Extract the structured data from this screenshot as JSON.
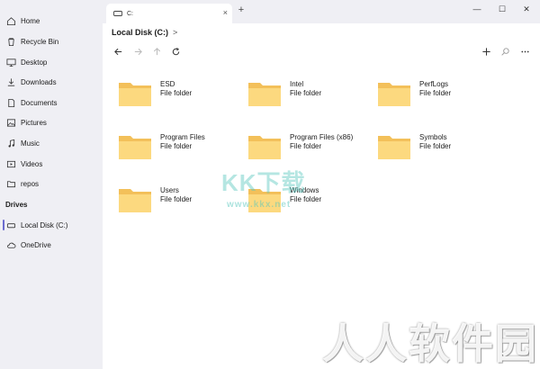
{
  "tab": {
    "title": "C:",
    "close_glyph": "×",
    "new_tab_glyph": "+"
  },
  "window_controls": {
    "minimize": "—",
    "maximize": "☐",
    "close": "✕"
  },
  "sidebar": {
    "items": [
      {
        "label": "Home",
        "icon": "home-icon"
      },
      {
        "label": "Recycle Bin",
        "icon": "recycle-bin-icon"
      },
      {
        "label": "Desktop",
        "icon": "desktop-icon"
      },
      {
        "label": "Downloads",
        "icon": "downloads-icon"
      },
      {
        "label": "Documents",
        "icon": "documents-icon"
      },
      {
        "label": "Pictures",
        "icon": "pictures-icon"
      },
      {
        "label": "Music",
        "icon": "music-icon"
      },
      {
        "label": "Videos",
        "icon": "videos-icon"
      },
      {
        "label": "repos",
        "icon": "folder-icon"
      }
    ],
    "drives_label": "Drives",
    "drives": [
      {
        "label": "Local Disk (C:)",
        "icon": "drive-icon",
        "selected": true
      },
      {
        "label": "OneDrive",
        "icon": "cloud-icon"
      }
    ]
  },
  "breadcrumb": {
    "location": "Local Disk (C:)",
    "chevron": ">"
  },
  "folders": [
    {
      "name": "ESD",
      "type": "File folder"
    },
    {
      "name": "Intel",
      "type": "File folder"
    },
    {
      "name": "PerfLogs",
      "type": "File folder"
    },
    {
      "name": "Program Files",
      "type": "File folder"
    },
    {
      "name": "Program Files (x86)",
      "type": "File folder"
    },
    {
      "name": "Symbols",
      "type": "File folder"
    },
    {
      "name": "Users",
      "type": "File folder"
    },
    {
      "name": "Windows",
      "type": "File folder"
    }
  ],
  "watermarks": {
    "kk_title": "KK下载",
    "kk_url": "www.kkx.net",
    "bottom": "人人软件园"
  },
  "colors": {
    "accent": "#6b6bcf",
    "folder_body": "#fcd97f",
    "folder_back": "#f3c05a",
    "sidebar_bg": "#efeff4"
  }
}
